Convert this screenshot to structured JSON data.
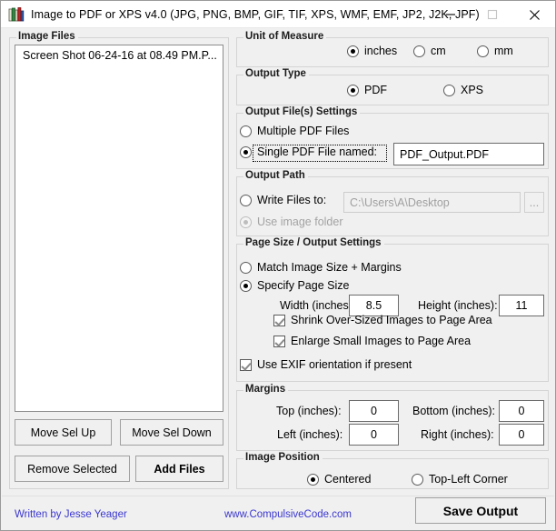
{
  "window": {
    "title": "Image to PDF or XPS  v4.0   (JPG, PNG, BMP, GIF, TIF, XPS, WMF, EMF, JP2, J2K, JPF)",
    "icon": "books-stack-icon",
    "minimize_label": "minimize-icon",
    "maximize_label": "maximize-icon",
    "close_label": "close-icon"
  },
  "image_files": {
    "legend": "Image Files",
    "items": [
      "Screen Shot 06-24-16 at 08.49 PM.P..."
    ],
    "buttons": {
      "move_up": "Move Sel Up",
      "move_down": "Move Sel Down",
      "remove_selected": "Remove Selected",
      "add_files": "Add Files"
    }
  },
  "unit_of_measure": {
    "legend": "Unit of Measure",
    "options": [
      "inches",
      "cm",
      "mm"
    ],
    "selected": "inches"
  },
  "output_type": {
    "legend": "Output Type",
    "options": [
      "PDF",
      "XPS"
    ],
    "selected": "PDF"
  },
  "output_file_settings": {
    "legend": "Output File(s) Settings",
    "multiple_label": "Multiple PDF Files",
    "single_label": "Single PDF File named:",
    "selected": "Single PDF File named:",
    "filename_value": "PDF_Output.PDF"
  },
  "output_path": {
    "legend": "Output Path",
    "write_files_label": "Write Files to:",
    "path_value": "C:\\Users\\A\\Desktop",
    "browse_label": "...",
    "use_image_folder_label": "Use image folder",
    "selected": "Use image folder"
  },
  "page_size": {
    "legend": "Page Size / Output Settings",
    "match_label": "Match Image Size + Margins",
    "specify_label": "Specify Page Size",
    "selected": "Specify Page Size",
    "width_label": "Width (inches):",
    "width_value": "8.5",
    "height_label": "Height (inches):",
    "height_value": "11",
    "shrink_label": "Shrink Over-Sized Images to Page Area",
    "shrink_checked": true,
    "enlarge_label": "Enlarge Small Images to Page Area",
    "enlarge_checked": true,
    "exif_label": "Use EXIF orientation if present",
    "exif_checked": true
  },
  "margins": {
    "legend": "Margins",
    "top_label": "Top (inches):",
    "top_value": "0",
    "bottom_label": "Bottom (inches):",
    "bottom_value": "0",
    "left_label": "Left (inches):",
    "left_value": "0",
    "right_label": "Right (inches):",
    "right_value": "0"
  },
  "image_position": {
    "legend": "Image Position",
    "options": [
      "Centered",
      "Top-Left Corner"
    ],
    "selected": "Centered"
  },
  "footer": {
    "author": "Written by Jesse Yeager",
    "website": "www.CompulsiveCode.com",
    "save_label": "Save Output",
    "link_color": "#3a36d0"
  }
}
